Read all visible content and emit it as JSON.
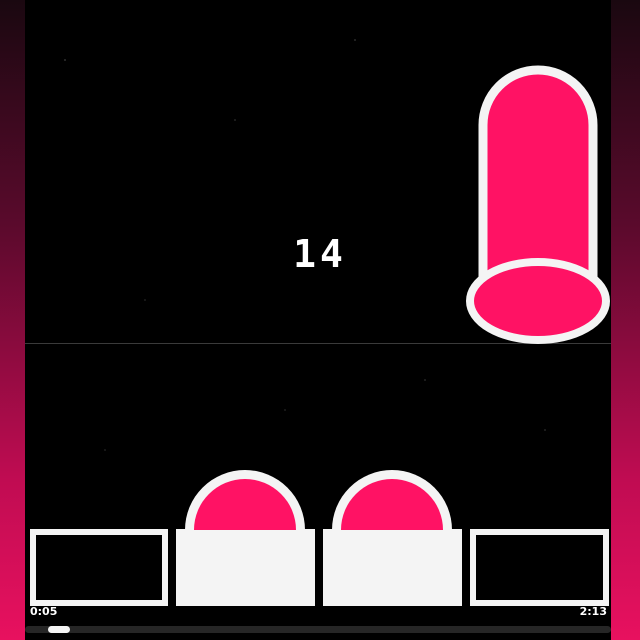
{
  "game": {
    "score": "14",
    "accent_color": "#ff1264",
    "tile_color": "#f4f4f4",
    "background_color": "#000000",
    "lanes": [
      {
        "state": "empty",
        "pressed": false
      },
      {
        "state": "pressed",
        "pressed": true
      },
      {
        "state": "pressed",
        "pressed": true
      },
      {
        "state": "empty",
        "pressed": false
      }
    ],
    "falling_note": {
      "type": "long-hold",
      "lane": 4
    }
  },
  "playback": {
    "elapsed": "0:05",
    "duration": "2:13",
    "progress_fraction": 0.04
  }
}
